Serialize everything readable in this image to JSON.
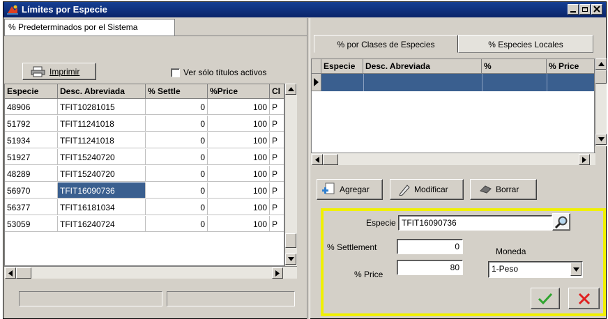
{
  "window": {
    "title": "Límites por Especie"
  },
  "left": {
    "tab_label": "% Predeterminados por el Sistema",
    "print_label": "Imprimir",
    "checkbox_label": "Ver sólo títulos activos",
    "columns": [
      "Especie",
      "Desc. Abreviada",
      "% Settle",
      "%Price",
      "Cl"
    ],
    "rows": [
      {
        "especie": "48906",
        "desc": "TFIT10281015",
        "settle": "0",
        "price": "100",
        "cl": "P"
      },
      {
        "especie": "51792",
        "desc": "TFIT11241018",
        "settle": "0",
        "price": "100",
        "cl": "P"
      },
      {
        "especie": "51934",
        "desc": "TFIT11241018",
        "settle": "0",
        "price": "100",
        "cl": "P"
      },
      {
        "especie": "51927",
        "desc": "TFIT15240720",
        "settle": "0",
        "price": "100",
        "cl": "P"
      },
      {
        "especie": "48289",
        "desc": "TFIT15240720",
        "settle": "0",
        "price": "100",
        "cl": "P"
      },
      {
        "especie": "56970",
        "desc": "TFIT16090736",
        "settle": "0",
        "price": "100",
        "cl": "P"
      },
      {
        "especie": "56377",
        "desc": "TFIT16181034",
        "settle": "0",
        "price": "100",
        "cl": "P"
      },
      {
        "especie": "53059",
        "desc": "TFIT16240724",
        "settle": "0",
        "price": "100",
        "cl": "P"
      }
    ],
    "selected_row": 5
  },
  "right": {
    "tabs": [
      "% por Clases de Especies",
      "% Especies Locales"
    ],
    "columns": [
      "Especie",
      "Desc. Abreviada",
      "%",
      "% Price"
    ],
    "buttons": {
      "add": "Agregar",
      "edit": "Modificar",
      "delete": "Borrar"
    },
    "form": {
      "especie_label": "Especie",
      "especie_value": "TFIT16090736",
      "settlement_label": "% Settlement",
      "settlement_value": "0",
      "price_label": "% Price",
      "price_value": "80",
      "moneda_label": "Moneda",
      "moneda_value": "1-Peso"
    }
  },
  "icons": {
    "title": "app-icon",
    "print": "printer-icon",
    "add": "add-icon",
    "edit": "pencil-icon",
    "delete": "eraser-icon",
    "search": "magnifier-icon",
    "ok": "checkmark-icon",
    "cancel": "x-icon"
  },
  "colors": {
    "title_bar": "#0a246a",
    "selection": "#3a5f8f",
    "highlight_border": "#f0f000",
    "ok": "#2fa52f",
    "cancel": "#e02020"
  }
}
